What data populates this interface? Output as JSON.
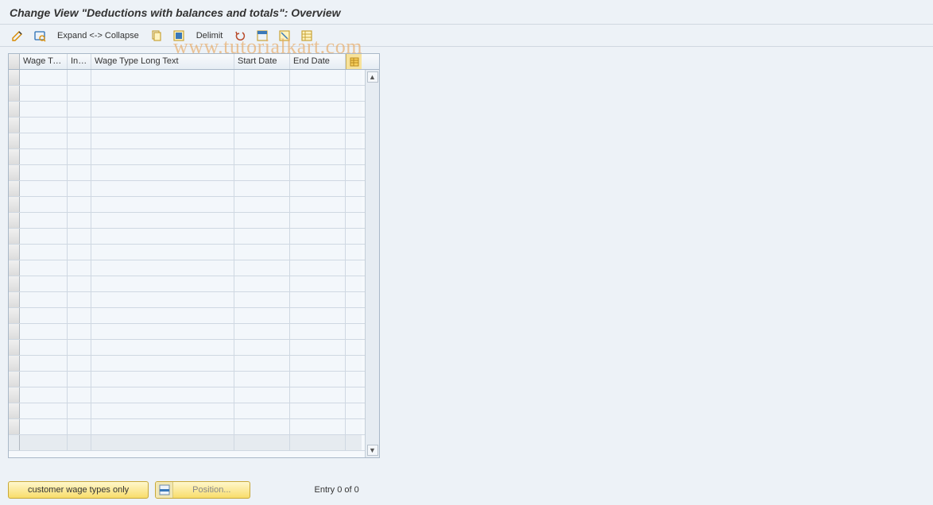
{
  "title": "Change View \"Deductions with balances and totals\": Overview",
  "toolbar": {
    "expand_label": "Expand <-> Collapse",
    "delimit_label": "Delimit"
  },
  "table": {
    "columns": {
      "wage_type": "Wage Ty...",
      "inf": "Inf...",
      "long_text": "Wage Type Long Text",
      "start_date": "Start Date",
      "end_date": "End Date"
    },
    "row_count": 24,
    "rows": []
  },
  "footer": {
    "customer_btn": "customer wage types only",
    "position_btn": "Position...",
    "entry_status": "Entry 0 of 0"
  },
  "watermark": "www.tutorialkart.com"
}
